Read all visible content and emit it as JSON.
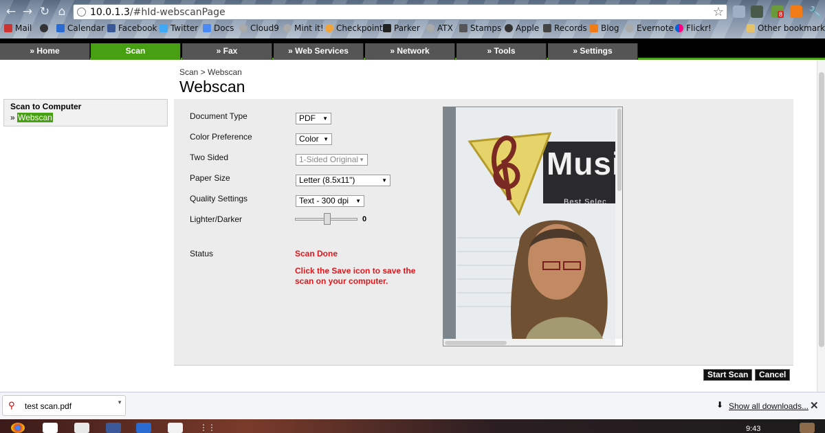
{
  "browser": {
    "url_host": "10.0.1.3",
    "url_path": "/#hId-webscanPage",
    "bookmarks": [
      "Mail",
      "Calendar",
      "Facebook",
      "Twitter",
      "Docs",
      "Cloud9",
      "Mint it!",
      "Checkpoint",
      "Parker",
      "ATX",
      "Stamps",
      "Apple",
      "Records",
      "Blog",
      "Evernote",
      "Flickr!"
    ],
    "other_bookmarks": "Other bookmarks",
    "ext_badge": "8"
  },
  "printer_nav": {
    "tabs": [
      "» Home",
      "Scan",
      "» Fax",
      "» Web Services",
      "» Network",
      "» Tools",
      "» Settings"
    ],
    "active_tab": "Scan"
  },
  "breadcrumb": "Scan > Webscan",
  "page_title": "Webscan",
  "sidebar": {
    "heading": "Scan to Computer",
    "prefix": "»",
    "link": "Webscan"
  },
  "settings": {
    "document_type": {
      "label": "Document Type",
      "value": "PDF"
    },
    "color_preference": {
      "label": "Color Preference",
      "value": "Color"
    },
    "two_sided": {
      "label": "Two Sided",
      "value": "1-Sided Original"
    },
    "paper_size": {
      "label": "Paper Size",
      "value": "Letter (8.5x11\")"
    },
    "quality": {
      "label": "Quality Settings",
      "value": "Text - 300 dpi"
    },
    "lighter_darker": {
      "label": "Lighter/Darker",
      "value": "0"
    }
  },
  "status": {
    "label": "Status",
    "value": "Scan Done",
    "message": "Click the Save icon to save the scan on your computer."
  },
  "preview": {
    "logo_text": "Musi",
    "subtitle": "Best Selec"
  },
  "buttons": {
    "start_scan": "Start Scan",
    "cancel": "Cancel"
  },
  "downloads": {
    "filename": "test scan.pdf",
    "show_all": "Show all downloads..."
  },
  "taskbar": {
    "clock": "9:43"
  },
  "colors": {
    "accent_green": "#47a012",
    "status_red": "#e0161b"
  }
}
